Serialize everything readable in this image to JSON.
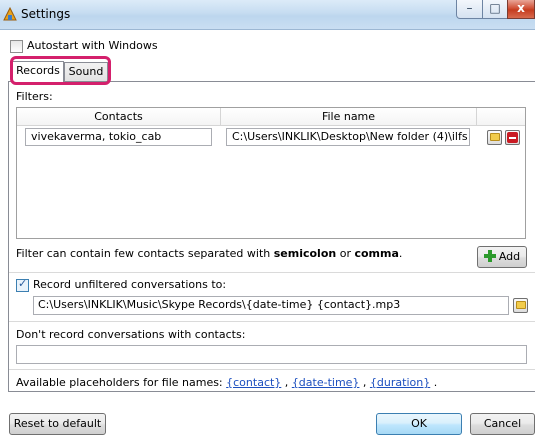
{
  "window": {
    "title": "Settings",
    "min_glyph": "–",
    "max_glyph": "□",
    "close_glyph": "x"
  },
  "autostart": {
    "label": "Autostart with Windows",
    "checked": false
  },
  "tabs": [
    {
      "label": "Records",
      "active": true
    },
    {
      "label": "Sound",
      "active": false
    }
  ],
  "filters": {
    "label": "Filters:",
    "headers": {
      "contacts": "Contacts",
      "file_name": "File name"
    },
    "rows": [
      {
        "contacts": "vivekaverma, tokio_cab",
        "file_name": "C:\\Users\\INKLIK\\Desktop\\New folder (4)\\ilfs"
      }
    ],
    "hint_prefix": "Filter can contain few contacts separated with ",
    "hint_semicolon": "semicolon",
    "hint_or": " or ",
    "hint_comma": "comma",
    "hint_suffix": ".",
    "add_label": "Add"
  },
  "record_unfiltered": {
    "label": "Record unfiltered conversations to:",
    "checked": true,
    "path": "C:\\Users\\INKLIK\\Music\\Skype Records\\{date-time} {contact}.mp3"
  },
  "dont_record": {
    "label": "Don't record conversations with contacts:",
    "value": ""
  },
  "placeholders": {
    "prefix": "Available placeholders for file names: ",
    "contact": "{contact}",
    "date_time": "{date-time}",
    "duration": "{duration}",
    "sep": " , ",
    "suffix": " ."
  },
  "buttons": {
    "reset": "Reset to default",
    "ok": "OK",
    "cancel": "Cancel"
  }
}
